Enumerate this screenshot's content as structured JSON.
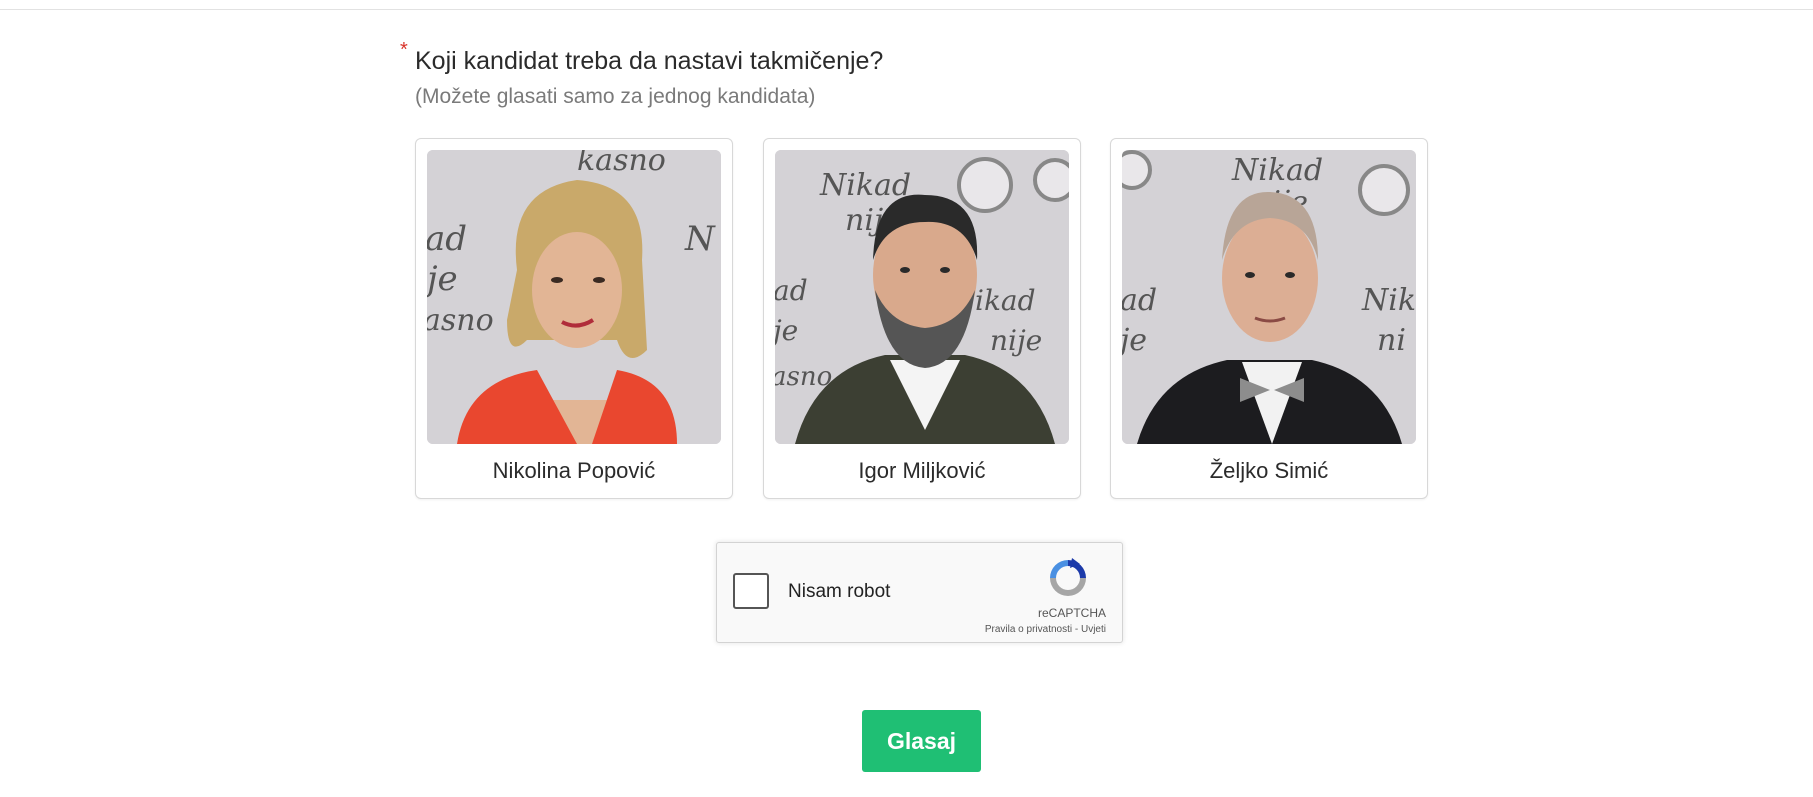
{
  "question": {
    "required_mark": "*",
    "title": "Koji kandidat treba da nastavi takmičenje?",
    "hint": "(Možete glasati samo za jednog kandidata)"
  },
  "candidates": [
    {
      "name": "Nikolina Popović"
    },
    {
      "name": "Igor Miljković"
    },
    {
      "name": "Željko Simić"
    }
  ],
  "captcha": {
    "label": "Nisam robot",
    "brand": "reCAPTCHA",
    "privacy_link": "Pravila o privatnosti",
    "separator": " - ",
    "terms_link": "Uvjeti"
  },
  "vote_button": {
    "label": "Glasaj",
    "color": "#1fbf74"
  },
  "colors": {
    "required": "#d9342b",
    "photo_background": "#d2d0d4"
  }
}
